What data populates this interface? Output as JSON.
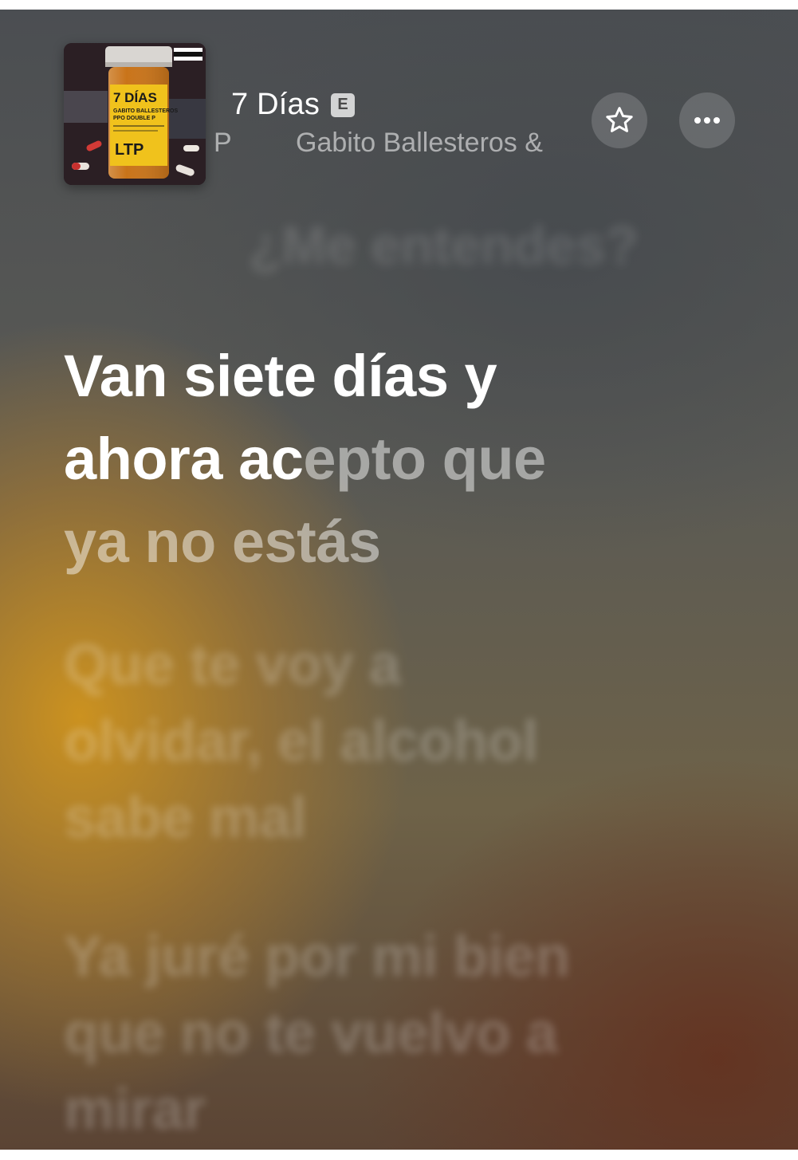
{
  "player": {
    "song_title": "7 Días",
    "explicit_badge": "E",
    "artist_fragment": "P",
    "artist_line": "Gabito Ballesteros &",
    "album_art": {
      "title_text": "7 DÍAS",
      "credit_line_1": "GABITO BALLESTEROS",
      "credit_line_2": "PPO DOUBLE P",
      "advisory": "PARENTAL ADVISORY",
      "logo": "LTP"
    }
  },
  "actions": {
    "favorite_icon": "star-icon",
    "more_icon": "ellipsis-icon"
  },
  "lyrics": {
    "previous": "¿Me entendes?",
    "current_sung_1": "Van siete días y",
    "current_sung_2": "ahora ac",
    "current_unsung_2": "epto que",
    "current_unsung_3": "ya no estás",
    "next_1": [
      "Que te voy a",
      "olvidar, el alcohol",
      "sabe mal"
    ],
    "next_2": [
      "Ya juré por mi bien",
      "que no te vuelvo a",
      "mirar"
    ]
  }
}
